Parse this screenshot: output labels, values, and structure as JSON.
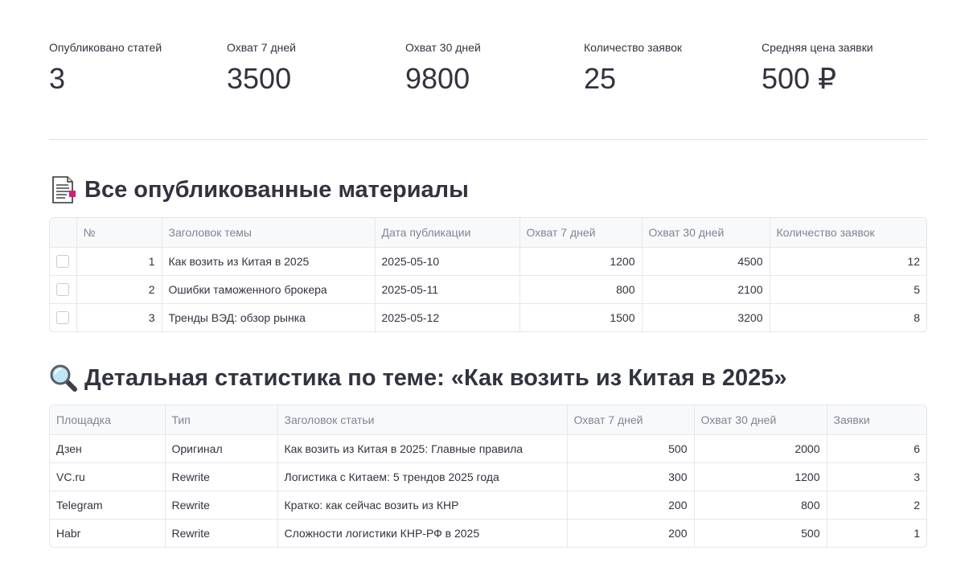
{
  "metrics": [
    {
      "label": "Опубликовано статей",
      "value": "3"
    },
    {
      "label": "Охват 7 дней",
      "value": "3500"
    },
    {
      "label": "Охват 30 дней",
      "value": "9800"
    },
    {
      "label": "Количество заявок",
      "value": "25"
    },
    {
      "label": "Средняя цена заявки",
      "value": "500 ₽"
    }
  ],
  "materials": {
    "title": "Все опубликованные материалы",
    "icon": "document-icon",
    "columns": [
      "",
      "№",
      "Заголовок темы",
      "Дата публикации",
      "Охват 7 дней",
      "Охват 30 дней",
      "Количество заявок"
    ],
    "rows": [
      [
        "1",
        "Как возить из Китая в 2025",
        "2025-05-10",
        "1200",
        "4500",
        "12"
      ],
      [
        "2",
        "Ошибки таможенного брокера",
        "2025-05-11",
        "800",
        "2100",
        "5"
      ],
      [
        "3",
        "Тренды ВЭД: обзор рынка",
        "2025-05-12",
        "1500",
        "3200",
        "8"
      ]
    ]
  },
  "details": {
    "title": "Детальная статистика по теме: «Как возить из Китая в 2025»",
    "icon": "magnifier-icon",
    "columns": [
      "Площадка",
      "Тип",
      "Заголовок статьи",
      "Охват 7 дней",
      "Охват 30 дней",
      "Заявки"
    ],
    "rows": [
      [
        "Дзен",
        "Оригинал",
        "Как возить из Китая в 2025: Главные правила",
        "500",
        "2000",
        "6"
      ],
      [
        "VC.ru",
        "Rewrite",
        "Логистика с Китаем: 5 трендов 2025 года",
        "300",
        "1200",
        "3"
      ],
      [
        "Telegram",
        "Rewrite",
        "Кратко: как сейчас возить из КНР",
        "200",
        "800",
        "2"
      ],
      [
        "Habr",
        "Rewrite",
        "Сложности логистики КНР-РФ в 2025",
        "200",
        "500",
        "1"
      ]
    ]
  }
}
